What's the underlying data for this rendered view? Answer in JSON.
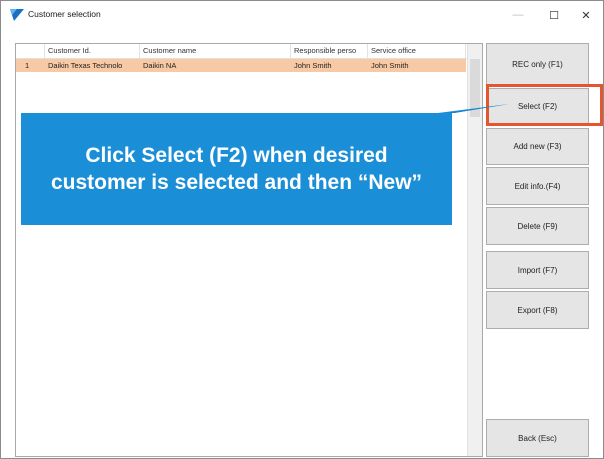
{
  "window": {
    "title": "Customer selection",
    "minimize_glyph": "—",
    "maximize_glyph": "☐",
    "close_glyph": "✕"
  },
  "table": {
    "columns": [
      "",
      "Customer Id.",
      "Customer name",
      "Responsible perso",
      "Service office"
    ],
    "rows": [
      [
        "1",
        "Daikin Texas Technolo",
        "Daikin NA",
        "John Smith",
        "John Smith"
      ]
    ],
    "selected_row_color": "#f7c9a4"
  },
  "buttons": {
    "rec_only": "REC only (F1)",
    "select": "Select (F2)",
    "add_new": "Add new (F3)",
    "edit_info": "Edit info.(F4)",
    "delete": "Delete (F9)",
    "import": "Import (F7)",
    "export": "Export (F8)",
    "back": "Back (Esc)"
  },
  "callout": {
    "text": "Click Select (F2) when desired customer is selected and then “New”",
    "color": "#1b8ed8",
    "highlight_color": "#e4572e"
  }
}
